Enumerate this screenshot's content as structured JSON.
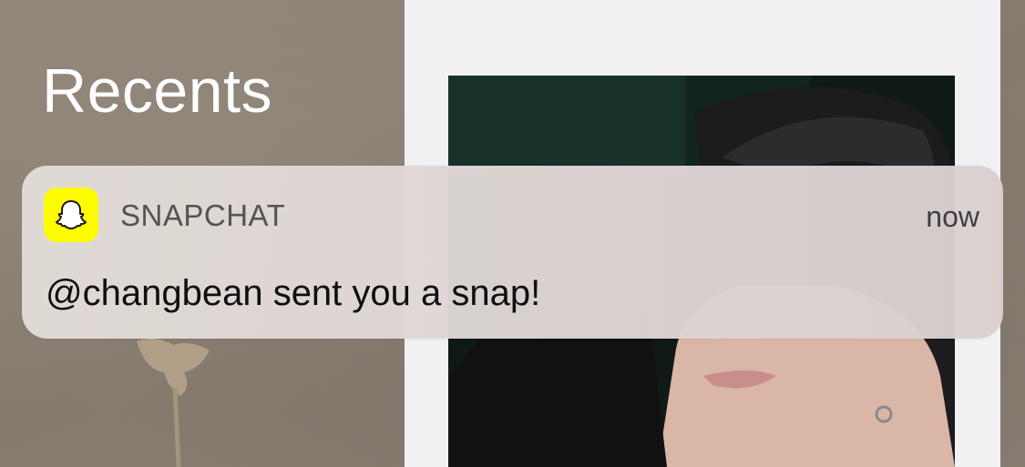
{
  "screen": {
    "section_title": "Recents"
  },
  "notification": {
    "app_name": "SNAPCHAT",
    "app_icon": "snapchat-ghost-icon",
    "timestamp": "now",
    "message": "@changbean sent you a snap!"
  },
  "colors": {
    "snapchat_yellow": "#fffc00",
    "notification_bg": "#dcd5d2",
    "wallpaper": "#8a7f73"
  }
}
